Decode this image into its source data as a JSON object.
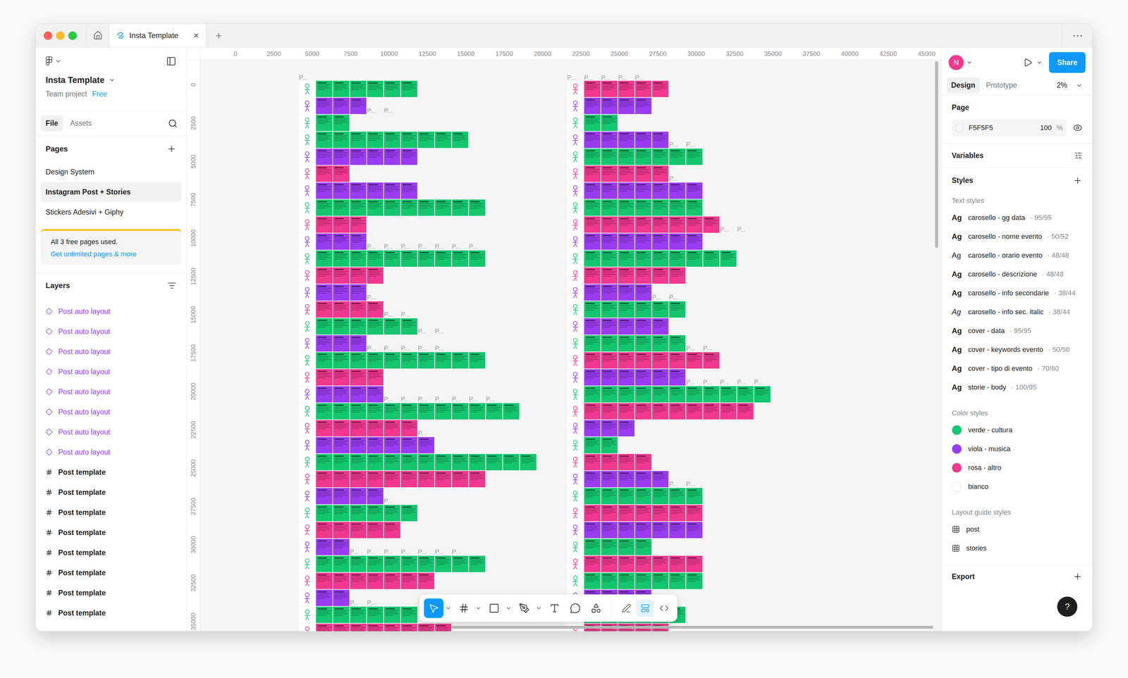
{
  "window": {
    "tab_title": "Insta Template",
    "tab_close": "×",
    "new_tab": "+",
    "menu": "⋯"
  },
  "sidebar": {
    "file_name": "Insta Template",
    "team": "Team project",
    "plan": "Free",
    "tabs": [
      {
        "label": "File",
        "selected": true
      },
      {
        "label": "Assets",
        "selected": false
      }
    ],
    "pages_title": "Pages",
    "pages": [
      {
        "label": "Design System",
        "selected": false
      },
      {
        "label": "Instagram Post + Stories",
        "selected": true
      },
      {
        "label": "Stickers Adesivi + Giphy",
        "selected": false
      }
    ],
    "notice": {
      "text": "All 3 free pages used.",
      "link": "Get unlimited pages & more"
    },
    "layers_title": "Layers",
    "layers": [
      {
        "label": "Post auto layout",
        "kind": "instance"
      },
      {
        "label": "Post auto layout",
        "kind": "instance"
      },
      {
        "label": "Post auto layout",
        "kind": "instance"
      },
      {
        "label": "Post auto layout",
        "kind": "instance"
      },
      {
        "label": "Post auto layout",
        "kind": "instance"
      },
      {
        "label": "Post auto layout",
        "kind": "instance"
      },
      {
        "label": "Post auto layout",
        "kind": "instance"
      },
      {
        "label": "Post auto layout",
        "kind": "instance"
      },
      {
        "label": "Post template",
        "kind": "frame"
      },
      {
        "label": "Post template",
        "kind": "frame"
      },
      {
        "label": "Post template",
        "kind": "frame"
      },
      {
        "label": "Post template",
        "kind": "frame"
      },
      {
        "label": "Post template",
        "kind": "frame"
      },
      {
        "label": "Post template",
        "kind": "frame"
      },
      {
        "label": "Post template",
        "kind": "frame"
      },
      {
        "label": "Post template",
        "kind": "frame"
      }
    ]
  },
  "canvas": {
    "ruler_x": [
      "0",
      "2500",
      "5000",
      "7500",
      "10000",
      "12500",
      "15000",
      "17500",
      "20000",
      "22500",
      "25000",
      "27500",
      "30000",
      "32500",
      "35000",
      "37500",
      "40000",
      "42500",
      "45000"
    ],
    "ruler_y": [
      "0",
      "2500",
      "5000",
      "7500",
      "10000",
      "12500",
      "15000",
      "17500",
      "20000",
      "22500",
      "25000",
      "27500",
      "30000",
      "32500",
      "35000"
    ],
    "groups": [
      {
        "top_labels": [
          "P..."
        ],
        "rows": [
          {
            "color": "#14c66e",
            "count": 6,
            "labels": []
          },
          {
            "color": "#9a3cf2",
            "count": 3,
            "labels": [
              "P...",
              "P..."
            ]
          },
          {
            "color": "#14c66e",
            "count": 2,
            "labels": []
          },
          {
            "color": "#14c66e",
            "count": 9,
            "labels": []
          },
          {
            "color": "#9a3cf2",
            "count": 6,
            "labels": []
          },
          {
            "color": "#f0388e",
            "count": 2,
            "labels": []
          },
          {
            "color": "#9a3cf2",
            "count": 6,
            "labels": []
          },
          {
            "color": "#14c66e",
            "count": 10,
            "labels": []
          },
          {
            "color": "#f0388e",
            "count": 3,
            "labels": []
          },
          {
            "color": "#9a3cf2",
            "count": 3,
            "labels": [
              "P...",
              "P...",
              "P...",
              "P...",
              "P...",
              "P...",
              "P..."
            ]
          },
          {
            "color": "#14c66e",
            "count": 10,
            "labels": []
          },
          {
            "color": "#f0388e",
            "count": 4,
            "labels": []
          },
          {
            "color": "#9a3cf2",
            "count": 3,
            "labels": [
              "P..."
            ]
          },
          {
            "color": "#f0388e",
            "count": 4,
            "labels": [
              "P...",
              "P..."
            ]
          },
          {
            "color": "#14c66e",
            "count": 6,
            "labels": [
              "P...",
              "P..."
            ]
          },
          {
            "color": "#9a3cf2",
            "count": 3,
            "labels": [
              "P...",
              "P...",
              "P...",
              "P...",
              "P..."
            ]
          },
          {
            "color": "#14c66e",
            "count": 10,
            "labels": []
          },
          {
            "color": "#f0388e",
            "count": 4,
            "labels": []
          },
          {
            "color": "#9a3cf2",
            "count": 4,
            "labels": [
              "P...",
              "P...",
              "P...",
              "P...",
              "P...",
              "P...",
              "P..."
            ]
          },
          {
            "color": "#14c66e",
            "count": 12,
            "labels": []
          },
          {
            "color": "#f0388e",
            "count": 6,
            "labels": [
              "P..."
            ]
          },
          {
            "color": "#9a3cf2",
            "count": 7,
            "labels": []
          },
          {
            "color": "#14c66e",
            "count": 13,
            "labels": []
          },
          {
            "color": "#f0388e",
            "count": 10,
            "labels": []
          },
          {
            "color": "#9a3cf2",
            "count": 4,
            "labels": [
              "P..."
            ]
          },
          {
            "color": "#14c66e",
            "count": 6,
            "labels": []
          },
          {
            "color": "#f0388e",
            "count": 5,
            "labels": []
          },
          {
            "color": "#9a3cf2",
            "count": 2,
            "labels": [
              "P...",
              "P...",
              "P...",
              "P...",
              "P...",
              "P...",
              "P..."
            ]
          },
          {
            "color": "#14c66e",
            "count": 10,
            "labels": []
          },
          {
            "color": "#f0388e",
            "count": 7,
            "labels": []
          },
          {
            "color": "#9a3cf2",
            "count": 2,
            "labels": [
              "P...",
              "P..."
            ]
          },
          {
            "color": "#14c66e",
            "count": 6,
            "labels": []
          },
          {
            "color": "#f0388e",
            "count": 8,
            "labels": []
          }
        ]
      },
      {
        "top_labels": [
          "P...",
          "P...",
          "P...",
          "P...",
          "P..."
        ],
        "rows": [
          {
            "color": "#f0388e",
            "count": 5,
            "labels": []
          },
          {
            "color": "#9a3cf2",
            "count": 4,
            "labels": []
          },
          {
            "color": "#14c66e",
            "count": 2,
            "labels": []
          },
          {
            "color": "#9a3cf2",
            "count": 5,
            "labels": [
              "P...",
              "P..."
            ]
          },
          {
            "color": "#14c66e",
            "count": 7,
            "labels": []
          },
          {
            "color": "#f0388e",
            "count": 5,
            "labels": [
              "P..."
            ]
          },
          {
            "color": "#9a3cf2",
            "count": 7,
            "labels": []
          },
          {
            "color": "#14c66e",
            "count": 7,
            "labels": []
          },
          {
            "color": "#f0388e",
            "count": 8,
            "labels": [
              "P...",
              "P..."
            ]
          },
          {
            "color": "#9a3cf2",
            "count": 7,
            "labels": []
          },
          {
            "color": "#14c66e",
            "count": 9,
            "labels": []
          },
          {
            "color": "#f0388e",
            "count": 6,
            "labels": []
          },
          {
            "color": "#9a3cf2",
            "count": 4,
            "labels": [
              "P...",
              "P..."
            ]
          },
          {
            "color": "#14c66e",
            "count": 6,
            "labels": []
          },
          {
            "color": "#9a3cf2",
            "count": 5,
            "labels": []
          },
          {
            "color": "#14c66e",
            "count": 6,
            "labels": [
              "P...",
              "P..."
            ]
          },
          {
            "color": "#f0388e",
            "count": 8,
            "labels": []
          },
          {
            "color": "#9a3cf2",
            "count": 6,
            "labels": [
              "P...",
              "P...",
              "P...",
              "P...",
              "P..."
            ]
          },
          {
            "color": "#14c66e",
            "count": 11,
            "labels": []
          },
          {
            "color": "#f0388e",
            "count": 10,
            "labels": []
          },
          {
            "color": "#9a3cf2",
            "count": 3,
            "labels": []
          },
          {
            "color": "#14c66e",
            "count": 2,
            "labels": []
          },
          {
            "color": "#f0388e",
            "count": 4,
            "labels": []
          },
          {
            "color": "#9a3cf2",
            "count": 5,
            "labels": [
              "P...",
              "P..."
            ]
          },
          {
            "color": "#14c66e",
            "count": 7,
            "labels": []
          },
          {
            "color": "#f0388e",
            "count": 7,
            "labels": []
          },
          {
            "color": "#9a3cf2",
            "count": 7,
            "labels": []
          },
          {
            "color": "#14c66e",
            "count": 4,
            "labels": []
          },
          {
            "color": "#f0388e",
            "count": 7,
            "labels": []
          },
          {
            "color": "#14c66e",
            "count": 7,
            "labels": []
          },
          {
            "color": "#9a3cf2",
            "count": 4,
            "labels": []
          },
          {
            "color": "#14c66e",
            "count": 6,
            "labels": []
          },
          {
            "color": "#f0388e",
            "count": 5,
            "labels": []
          }
        ]
      }
    ]
  },
  "toolbar": {
    "tools": [
      {
        "name": "move",
        "selected": true,
        "menu": true
      },
      {
        "name": "frame",
        "selected": false,
        "menu": true
      },
      {
        "name": "rectangle",
        "selected": false,
        "menu": true
      },
      {
        "name": "pen",
        "selected": false,
        "menu": true
      },
      {
        "name": "text",
        "selected": false,
        "menu": false
      },
      {
        "name": "comment",
        "selected": false,
        "menu": false
      },
      {
        "name": "actions",
        "selected": false,
        "menu": false
      }
    ],
    "modes": [
      {
        "name": "draw",
        "selected": false
      },
      {
        "name": "design",
        "selected": true
      },
      {
        "name": "dev",
        "selected": false
      }
    ]
  },
  "inspector": {
    "avatar": "N",
    "share": "Share",
    "tabs": [
      {
        "label": "Design",
        "selected": true
      },
      {
        "label": "Prototype",
        "selected": false
      }
    ],
    "zoom": "2%",
    "page": {
      "title": "Page",
      "color": "#f5f5f5",
      "color_hex": "F5F5F5",
      "opacity": "100",
      "unit": "%"
    },
    "variables": "Variables",
    "styles": "Styles",
    "text_styles_title": "Text styles",
    "text_styles": [
      {
        "sample": "Ag",
        "name": "carosello - gg data",
        "meta": "· 95/95",
        "style": "bold"
      },
      {
        "sample": "Ag",
        "name": "carosello - nome evento",
        "meta": "· 50/52",
        "style": "bold"
      },
      {
        "sample": "Ag",
        "name": "carosello - orario evento",
        "meta": "· 48/48",
        "style": "regular"
      },
      {
        "sample": "Ag",
        "name": "carosello - descrizione",
        "meta": "· 48/48",
        "style": "bold"
      },
      {
        "sample": "Ag",
        "name": "carosello - info secondarie",
        "meta": "· 38/44",
        "style": "bold"
      },
      {
        "sample": "Ag",
        "name": "carosello - info sec. italic",
        "meta": "· 38/44",
        "style": "italic"
      },
      {
        "sample": "Ag",
        "name": "cover - data",
        "meta": "· 95/95",
        "style": "bold"
      },
      {
        "sample": "Ag",
        "name": "cover - keywords evento",
        "meta": "· 50/50",
        "style": "bold"
      },
      {
        "sample": "Ag",
        "name": "cover - tipo di evento",
        "meta": "· 70/60",
        "style": "bold"
      },
      {
        "sample": "Ag",
        "name": "storie - body",
        "meta": "· 100/95",
        "style": "bold"
      }
    ],
    "color_styles_title": "Color styles",
    "color_styles": [
      {
        "name": "verde - cultura",
        "color": "#14c66e"
      },
      {
        "name": "viola - musica",
        "color": "#9a3cf2"
      },
      {
        "name": "rosa - altro",
        "color": "#f0388e"
      },
      {
        "name": "bianco",
        "color": "#ffffff"
      }
    ],
    "layout_title": "Layout guide styles",
    "layout_styles": [
      "post",
      "stories"
    ],
    "export": "Export",
    "help": "?"
  }
}
